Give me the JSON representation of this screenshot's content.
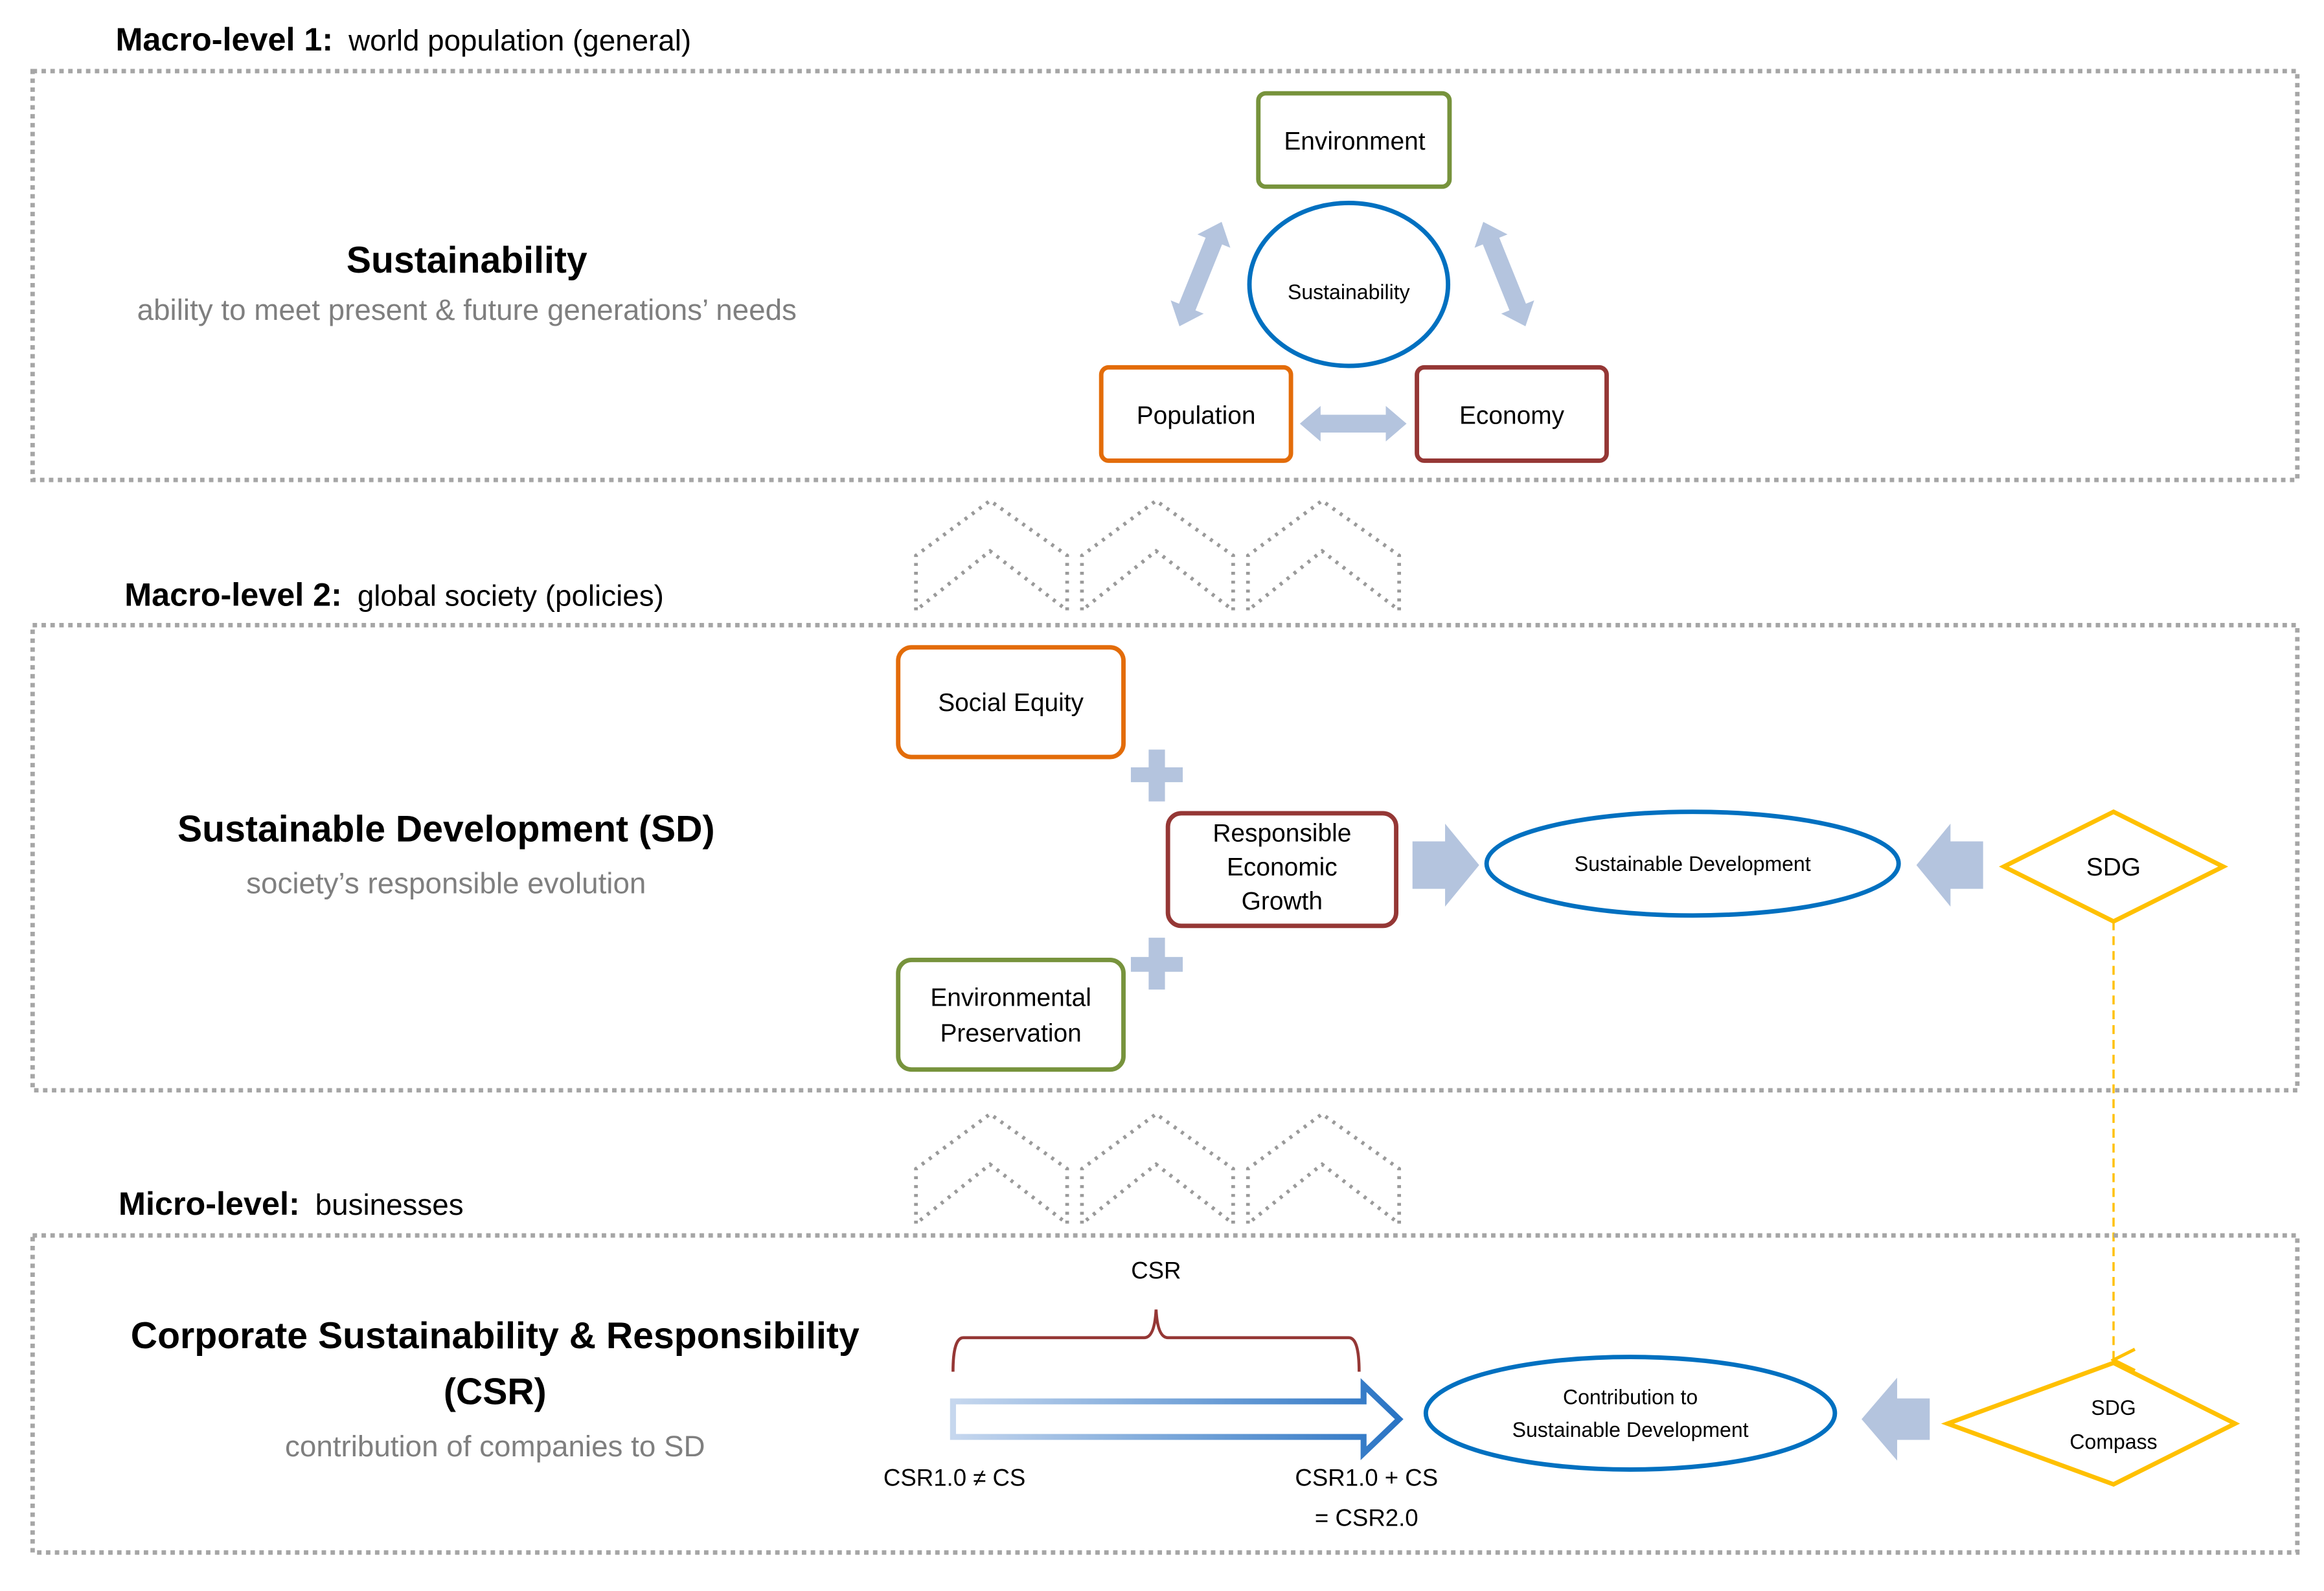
{
  "levels": [
    {
      "label_bold": "Macro-level 1:",
      "label_rest": "world population (general)",
      "title": "Sustainability",
      "subtitle": "ability to meet present & future generations’ needs",
      "nodes": {
        "top": "Environment",
        "center": "Sustainability",
        "left": "Population",
        "right": "Economy"
      }
    },
    {
      "label_bold": "Macro-level 2:",
      "label_rest": "global society (policies)",
      "title": "Sustainable Development (SD)",
      "subtitle": "society’s responsible evolution",
      "nodes": {
        "social": "Social Equity",
        "economic": [
          "Responsible",
          "Economic",
          "Growth"
        ],
        "environmental": [
          "Environmental",
          "Preservation"
        ],
        "result": "Sustainable Development",
        "source": "SDG"
      }
    },
    {
      "label_bold": "Micro-level:",
      "label_rest": "businesses",
      "title_lines": [
        "Corporate Sustainability & Responsibility",
        "(CSR)"
      ],
      "subtitle": "contribution of companies to SD",
      "nodes": {
        "brace_label": "CSR",
        "start_label": "CSR1.0 ≠ CS",
        "end_label": [
          "CSR1.0 + CS",
          "= CSR2.0"
        ],
        "result": [
          "Contribution to",
          "Sustainable Development"
        ],
        "source": [
          "SDG",
          "Compass"
        ]
      }
    }
  ],
  "colors": {
    "environment": "#77933c",
    "population": "#e36c09",
    "economy": "#953735",
    "sustainability": "#0070c0",
    "sdg": "#ffc000",
    "connector": "#b4c4de",
    "frame": "#a6a6a6",
    "subtitle": "#7f7f7f"
  }
}
